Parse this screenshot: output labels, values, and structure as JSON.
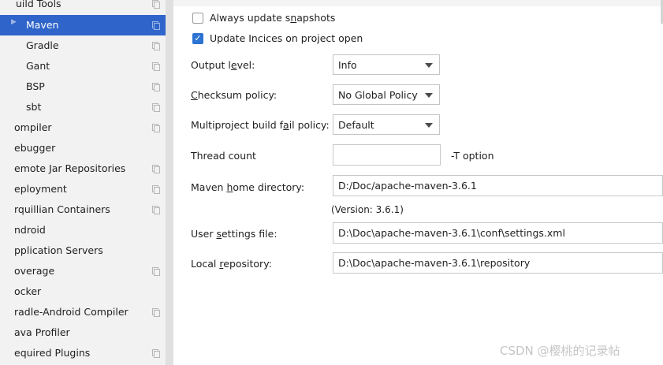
{
  "sidebar": {
    "items": [
      {
        "label": "uild Tools",
        "copy": true
      },
      {
        "label": "Maven",
        "copy": true,
        "selected": true
      },
      {
        "label": "Gradle",
        "copy": true
      },
      {
        "label": "Gant",
        "copy": true
      },
      {
        "label": "BSP",
        "copy": true
      },
      {
        "label": "sbt",
        "copy": true
      },
      {
        "label": "ompiler",
        "copy": true
      },
      {
        "label": "ebugger",
        "copy": false
      },
      {
        "label": "emote Jar Repositories",
        "copy": true
      },
      {
        "label": "eployment",
        "copy": true
      },
      {
        "label": "rquillian Containers",
        "copy": true
      },
      {
        "label": "ndroid",
        "copy": false
      },
      {
        "label": "pplication Servers",
        "copy": false
      },
      {
        "label": "overage",
        "copy": true
      },
      {
        "label": "ocker",
        "copy": false
      },
      {
        "label": "radle-Android Compiler",
        "copy": true
      },
      {
        "label": "ava Profiler",
        "copy": false
      },
      {
        "label": "equired Plugins",
        "copy": true
      }
    ]
  },
  "settings": {
    "always_update_snapshots": {
      "label_pre": "Always update s",
      "label_u": "n",
      "label_post": "apshots",
      "checked": false
    },
    "update_indices": {
      "label": "Update Incices on project open",
      "checked": true
    },
    "output_level": {
      "label_pre": "Output l",
      "label_u": "e",
      "label_post": "vel:",
      "value": "Info"
    },
    "checksum_policy": {
      "label_pre": "",
      "label_u": "C",
      "label_post": "hecksum policy:",
      "value": "No Global Policy"
    },
    "multiproject_fail": {
      "label_pre": "Multiproject build f",
      "label_u": "a",
      "label_post": "il policy:",
      "value": "Default"
    },
    "thread_count": {
      "label": "Thread count",
      "value": "",
      "suffix": "-T option"
    },
    "maven_home": {
      "label_pre": "Maven ",
      "label_u": "h",
      "label_post": "ome directory:",
      "value": "D:/Doc/apache-maven-3.6.1",
      "version": "(Version: 3.6.1)"
    },
    "user_settings": {
      "label_pre": "User ",
      "label_u": "s",
      "label_post": "ettings file:",
      "value": "D:\\Doc\\apache-maven-3.6.1\\conf\\settings.xml"
    },
    "local_repo": {
      "label_pre": "Local ",
      "label_u": "r",
      "label_post": "epository:",
      "value": "D:\\Doc\\apache-maven-3.6.1\\repository"
    }
  },
  "watermark": "CSDN @樱桃的记录帖",
  "colors": {
    "selection": "#2f65ca",
    "checkbox_checked": "#2c73d3"
  }
}
